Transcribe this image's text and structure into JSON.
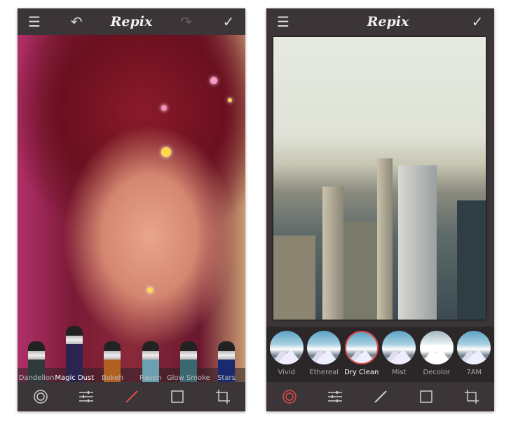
{
  "app_name": "Repix",
  "colors": {
    "accent": "#e24a4a",
    "bar": "#3b3538"
  },
  "left_screen": {
    "top_icons": [
      "menu-icon",
      "undo-icon",
      "redo-icon",
      "check-icon"
    ],
    "brushes": [
      {
        "label": "Dandelion",
        "color": "#2e3a3a"
      },
      {
        "label": "Magic Dust",
        "color": "#2a2550",
        "active": true
      },
      {
        "label": "Bokeh",
        "color": "#b06020"
      },
      {
        "label": "Raven",
        "color": "#6aa0b0"
      },
      {
        "label": "Glow Smoke",
        "color": "#3a6870"
      },
      {
        "label": "Stars",
        "color": "#1a2a70"
      }
    ],
    "active_tool": "brush"
  },
  "right_screen": {
    "top_icons": [
      "menu-icon",
      "check-icon"
    ],
    "filters": [
      {
        "label": "Vivid"
      },
      {
        "label": "Ethereal"
      },
      {
        "label": "Dry Clean",
        "active": true
      },
      {
        "label": "Mist"
      },
      {
        "label": "Decolor"
      },
      {
        "label": "7AM"
      }
    ],
    "active_tool": "filters"
  },
  "toolbar_icons": [
    "filters-icon",
    "adjust-icon",
    "brush-icon",
    "frame-icon",
    "crop-icon"
  ]
}
